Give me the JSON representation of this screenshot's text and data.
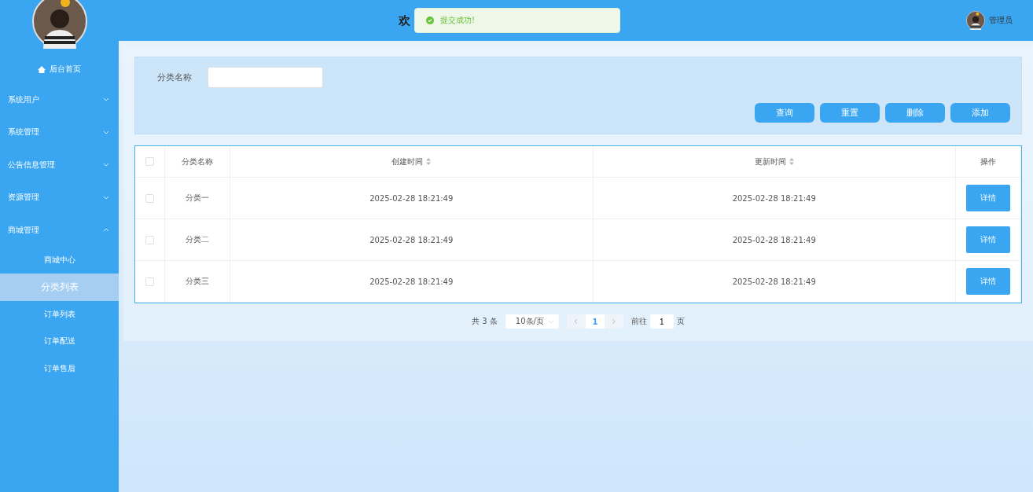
{
  "sidebar": {
    "home": "后台首页",
    "menus": [
      {
        "label": "系统用户",
        "expanded": false
      },
      {
        "label": "系统管理",
        "expanded": false
      },
      {
        "label": "公告信息管理",
        "expanded": false
      },
      {
        "label": "资源管理",
        "expanded": false
      },
      {
        "label": "商城管理",
        "expanded": true,
        "children": [
          {
            "label": "商城中心",
            "selected": false
          },
          {
            "label": "分类列表",
            "selected": true
          },
          {
            "label": "订单列表",
            "selected": false
          },
          {
            "label": "订单配送",
            "selected": false
          },
          {
            "label": "订单售后",
            "selected": false
          }
        ]
      }
    ]
  },
  "header": {
    "title": "欢",
    "user": "管理员"
  },
  "toast": {
    "message": "提交成功!"
  },
  "search": {
    "label": "分类名称",
    "buttons": [
      "查询",
      "重置",
      "删除",
      "添加"
    ]
  },
  "table": {
    "columns": [
      {
        "label": "分类名称",
        "sortable": false
      },
      {
        "label": "创建时间",
        "sortable": true
      },
      {
        "label": "更新时间",
        "sortable": true
      },
      {
        "label": "操作",
        "sortable": false
      }
    ],
    "header_checked": false,
    "rows": [
      {
        "checked": false,
        "name": "分类一",
        "created": "2025-02-28 18:21:49",
        "updated": "2025-02-28 18:21:49",
        "action": "详情"
      },
      {
        "checked": false,
        "name": "分类二",
        "created": "2025-02-28 18:21:49",
        "updated": "2025-02-28 18:21:49",
        "action": "详情"
      },
      {
        "checked": false,
        "name": "分类三",
        "created": "2025-02-28 18:21:49",
        "updated": "2025-02-28 18:21:49",
        "action": "详情"
      }
    ]
  },
  "pagination": {
    "total": "共 3 条",
    "page_size": "10条/页",
    "pages": [
      {
        "label": "1",
        "selected": true
      }
    ],
    "goto_label": "前往",
    "goto_value": "1",
    "page_unit": "页"
  }
}
